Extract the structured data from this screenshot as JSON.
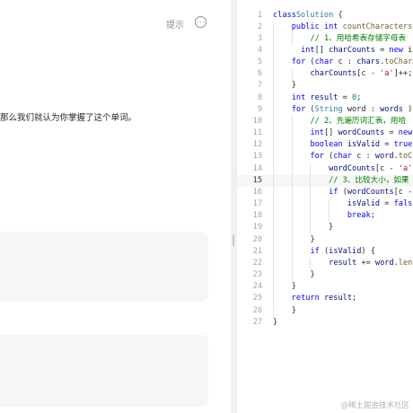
{
  "description_panel": {
    "hint_label": "提示",
    "more_icon": "more-icon",
    "text_fragment": "那么我们就认为你掌握了这个单词。",
    "quote_fragment": "\""
  },
  "editor": {
    "current_line": 15,
    "lines": [
      {
        "n": "1",
        "indent": 0,
        "tokens": [
          [
            "kw",
            "class"
          ],
          [
            "",
            ""
          ],
          [
            " ",
            ""
          ],
          [
            "cls",
            "Solution"
          ],
          [
            "",
            " {"
          ]
        ]
      },
      {
        "n": "2",
        "indent": 1,
        "tokens": [
          [
            "kw",
            "public"
          ],
          [
            "",
            " "
          ],
          [
            "kw",
            "int"
          ],
          [
            "",
            " "
          ],
          [
            "fn",
            "countCharacters("
          ]
        ]
      },
      {
        "n": "3",
        "indent": 2,
        "tokens": [
          [
            "cmt",
            "// 1、用哈希表存储字母表"
          ]
        ]
      },
      {
        "n": "4",
        "indent": 1.5,
        "tokens": [
          [
            "kw",
            "int"
          ],
          [
            "",
            "[] "
          ],
          [
            "var",
            "charCounts"
          ],
          [
            "",
            " = "
          ],
          [
            "kw",
            "new"
          ],
          [
            "",
            " in"
          ]
        ]
      },
      {
        "n": "5",
        "indent": 1,
        "tokens": [
          [
            "kw",
            "for"
          ],
          [
            "",
            " ("
          ],
          [
            "kw",
            "char"
          ],
          [
            "",
            " c : "
          ],
          [
            "var",
            "chars"
          ],
          [
            "",
            "."
          ],
          [
            "fn",
            "toCharA"
          ]
        ]
      },
      {
        "n": "6",
        "indent": 2,
        "tokens": [
          [
            "var",
            "charCounts"
          ],
          [
            "",
            "[c - "
          ],
          [
            "str",
            "'a'"
          ],
          [
            "",
            "]++;"
          ]
        ]
      },
      {
        "n": "7",
        "indent": 1,
        "tokens": [
          [
            "",
            "}"
          ]
        ]
      },
      {
        "n": "8",
        "indent": 1,
        "tokens": [
          [
            "kw",
            "int"
          ],
          [
            "",
            " "
          ],
          [
            "var",
            "result"
          ],
          [
            "",
            " = "
          ],
          [
            "num",
            "0"
          ],
          [
            "",
            ";"
          ]
        ]
      },
      {
        "n": "9",
        "indent": 1,
        "tokens": [
          [
            "kw",
            "for"
          ],
          [
            "",
            " ("
          ],
          [
            "cls",
            "String"
          ],
          [
            "",
            " word : "
          ],
          [
            "var",
            "words"
          ],
          [
            "",
            " ) {"
          ]
        ]
      },
      {
        "n": "10",
        "indent": 2,
        "tokens": [
          [
            "cmt",
            "// 2、先遍历词汇表，用哈"
          ]
        ]
      },
      {
        "n": "11",
        "indent": 2,
        "tokens": [
          [
            "kw",
            "int"
          ],
          [
            "",
            "[] "
          ],
          [
            "var",
            "wordCounts"
          ],
          [
            "",
            " = "
          ],
          [
            "kw",
            "new"
          ]
        ]
      },
      {
        "n": "12",
        "indent": 2,
        "tokens": [
          [
            "kw",
            "boolean"
          ],
          [
            "",
            " "
          ],
          [
            "var",
            "isValid"
          ],
          [
            "",
            " = "
          ],
          [
            "kw",
            "true"
          ],
          [
            "",
            ";"
          ]
        ]
      },
      {
        "n": "13",
        "indent": 2,
        "tokens": [
          [
            "kw",
            "for"
          ],
          [
            "",
            " ("
          ],
          [
            "kw",
            "char"
          ],
          [
            "",
            " c : "
          ],
          [
            "var",
            "word"
          ],
          [
            "",
            "."
          ],
          [
            "fn",
            "toCh"
          ]
        ]
      },
      {
        "n": "14",
        "indent": 3,
        "tokens": [
          [
            "var",
            "wordCounts"
          ],
          [
            "",
            "[c - "
          ],
          [
            "str",
            "'a'"
          ],
          [
            "",
            "]"
          ]
        ]
      },
      {
        "n": "15",
        "indent": 3,
        "tokens": [
          [
            "cmt",
            "// 3、比较大小，如果"
          ]
        ]
      },
      {
        "n": "16",
        "indent": 3,
        "tokens": [
          [
            "kw",
            "if"
          ],
          [
            "",
            " ("
          ],
          [
            "var",
            "wordCounts"
          ],
          [
            "",
            "[c -"
          ]
        ]
      },
      {
        "n": "17",
        "indent": 4,
        "tokens": [
          [
            "var",
            "isValid"
          ],
          [
            "",
            " = "
          ],
          [
            "kw",
            "false"
          ]
        ]
      },
      {
        "n": "18",
        "indent": 4,
        "tokens": [
          [
            "kw",
            "break"
          ],
          [
            "",
            ";"
          ]
        ]
      },
      {
        "n": "19",
        "indent": 3,
        "tokens": [
          [
            "",
            "}"
          ]
        ]
      },
      {
        "n": "20",
        "indent": 2,
        "tokens": [
          [
            "",
            "}"
          ]
        ]
      },
      {
        "n": "21",
        "indent": 2,
        "tokens": [
          [
            "kw",
            "if"
          ],
          [
            "",
            " ("
          ],
          [
            "var",
            "isValid"
          ],
          [
            "",
            ") {"
          ]
        ]
      },
      {
        "n": "22",
        "indent": 3,
        "tokens": [
          [
            "var",
            "result"
          ],
          [
            "",
            " += "
          ],
          [
            "var",
            "word"
          ],
          [
            "",
            "."
          ],
          [
            "fn",
            "leng"
          ]
        ]
      },
      {
        "n": "23",
        "indent": 2,
        "tokens": [
          [
            "",
            "}"
          ]
        ]
      },
      {
        "n": "24",
        "indent": 1,
        "tokens": [
          [
            "",
            "}"
          ]
        ]
      },
      {
        "n": "25",
        "indent": 1,
        "tokens": [
          [
            "kw",
            "return"
          ],
          [
            "",
            " "
          ],
          [
            "var",
            "result"
          ],
          [
            "",
            ";"
          ]
        ]
      },
      {
        "n": "26",
        "indent": 1,
        "tokens": [
          [
            "",
            "}"
          ]
        ]
      },
      {
        "n": "27",
        "indent": 0,
        "tokens": [
          [
            "",
            "}"
          ]
        ]
      }
    ]
  },
  "watermark": "@稀土掘金技术社区",
  "colors": {
    "keyword": "#0000ff",
    "comment": "#008000",
    "string": "#a31515",
    "number": "#098658"
  }
}
